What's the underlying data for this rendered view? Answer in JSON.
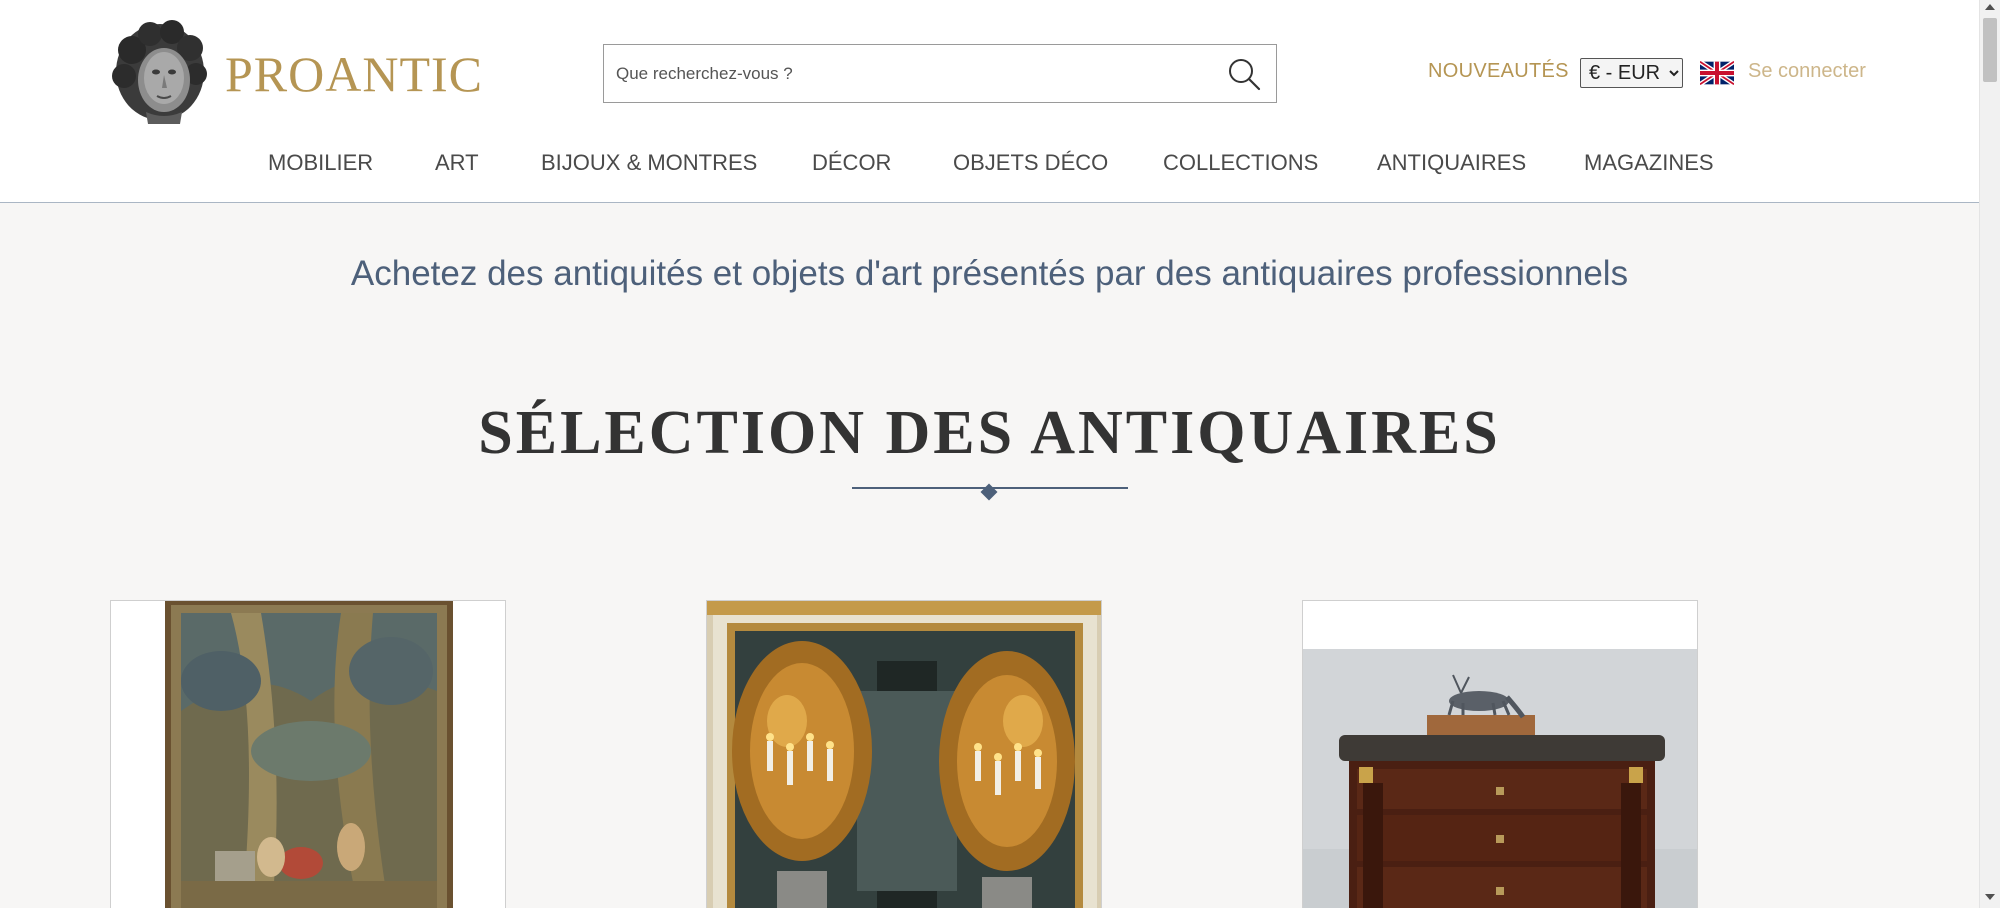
{
  "header": {
    "brand": "PROANTIC",
    "search": {
      "placeholder": "Que recherchez-vous ?",
      "value": ""
    },
    "nouveautes": "NOUVEAUTÉS",
    "currency": {
      "selected": "€ - EUR",
      "options": [
        "€ - EUR"
      ]
    },
    "language_flag": "uk-flag-icon",
    "login": "Se connecter"
  },
  "nav": {
    "items": [
      {
        "label": "MOBILIER"
      },
      {
        "label": "ART"
      },
      {
        "label": "BIJOUX & MONTRES"
      },
      {
        "label": "DÉCOR"
      },
      {
        "label": "OBJETS DÉCO"
      },
      {
        "label": "COLLECTIONS"
      },
      {
        "label": "ANTIQUAIRES"
      },
      {
        "label": "MAGAZINES"
      }
    ]
  },
  "main": {
    "tagline": "Achetez des antiquités et objets d'art présentés par des antiquaires professionnels",
    "section_title": "SÉLECTION DES ANTIQUAIRES",
    "cards": [
      {
        "image": "tapestry-image"
      },
      {
        "image": "gilded-candelabra-pair-image"
      },
      {
        "image": "mahogany-commode-with-deer-bronze-image"
      }
    ]
  },
  "colors": {
    "brand_gold": "#b59553",
    "login_gold": "#cdb68a",
    "slate_blue": "#4d607a",
    "page_bg": "#f7f6f5"
  }
}
